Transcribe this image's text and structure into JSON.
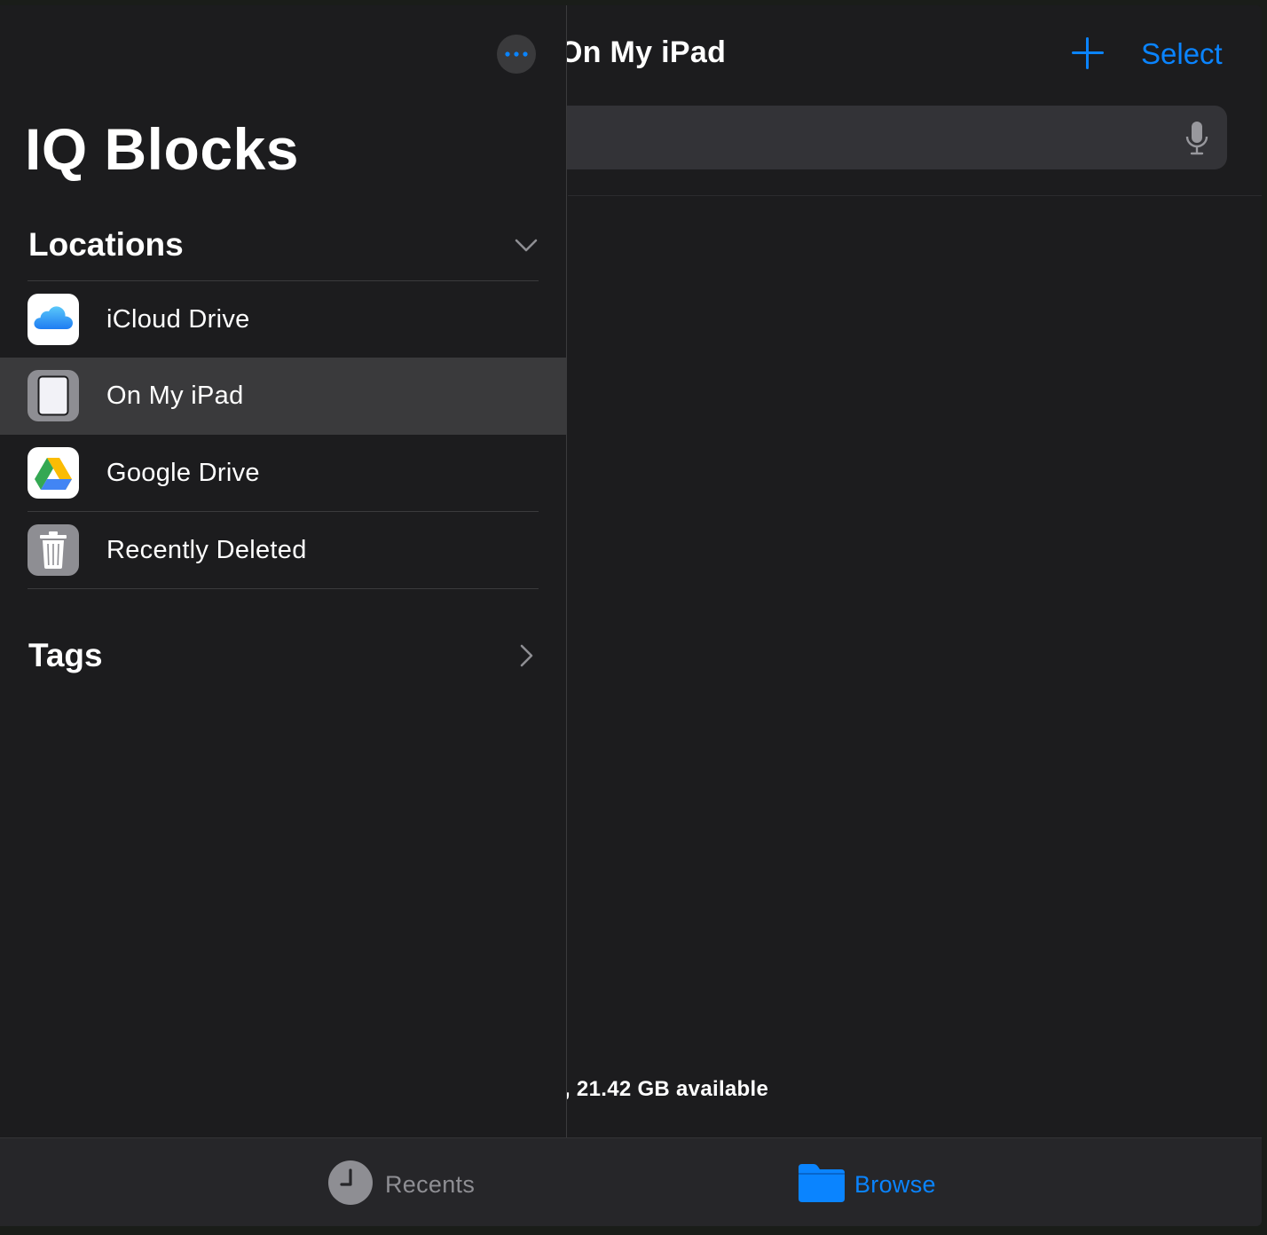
{
  "main": {
    "title": "On My iPad",
    "select_label": "Select",
    "storage_text": ", 21.42 GB available"
  },
  "sidebar": {
    "title": "IQ Blocks",
    "locations_header": "Locations",
    "tags_header": "Tags",
    "locations": [
      {
        "label": "iCloud Drive",
        "icon": "icloud-icon"
      },
      {
        "label": "On My iPad",
        "icon": "ipad-icon",
        "selected": true
      },
      {
        "label": "Google Drive",
        "icon": "google-drive-icon"
      },
      {
        "label": "Recently Deleted",
        "icon": "trash-icon"
      }
    ]
  },
  "tabbar": {
    "recents_label": "Recents",
    "browse_label": "Browse"
  },
  "colors": {
    "accent": "#0a84ff",
    "background": "#1c1c1e",
    "selected_row": "#3a3a3c",
    "inactive_tab": "#8e8e93"
  }
}
